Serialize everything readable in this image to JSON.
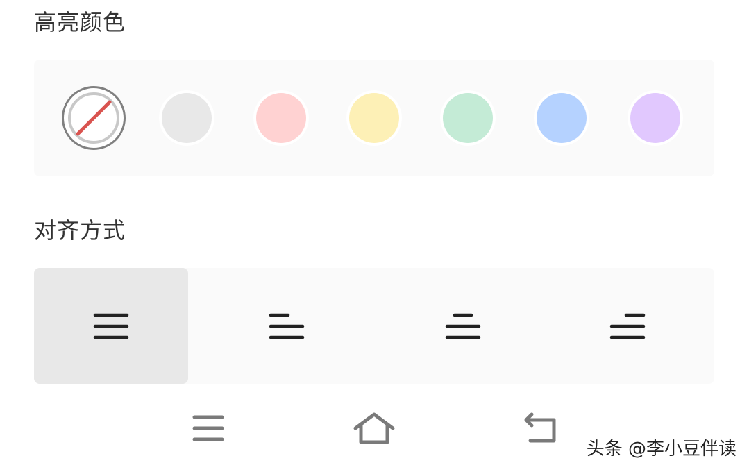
{
  "highlight_section": {
    "title": "高亮颜色",
    "none_option": {
      "icon": "no-color-slash-icon"
    },
    "colors": [
      {
        "name": "gray",
        "hex": "#e8e8e8"
      },
      {
        "name": "red",
        "hex": "#ffd2d2"
      },
      {
        "name": "yellow",
        "hex": "#fdf0b6"
      },
      {
        "name": "green",
        "hex": "#c4ebd6"
      },
      {
        "name": "blue",
        "hex": "#b5d2ff"
      },
      {
        "name": "purple",
        "hex": "#e1c8fe"
      }
    ]
  },
  "align_section": {
    "title": "对齐方式",
    "selected": "justify",
    "options": [
      {
        "id": "justify",
        "icon": "align-justify-icon"
      },
      {
        "id": "left",
        "icon": "align-left-icon"
      },
      {
        "id": "center",
        "icon": "align-center-icon"
      },
      {
        "id": "right",
        "icon": "align-right-icon"
      }
    ]
  },
  "navbar": {
    "buttons": [
      {
        "id": "menu",
        "icon": "menu-icon"
      },
      {
        "id": "home",
        "icon": "home-icon"
      },
      {
        "id": "back",
        "icon": "back-icon"
      }
    ]
  },
  "watermark": {
    "text": "头条 @李小豆伴读"
  },
  "colors": {
    "title_text": "#333333",
    "panel_bg": "#fafafa",
    "selected_bg": "#e8e8e8",
    "icon_dark": "#222222",
    "nav_icon": "#7a7a7a",
    "slash_red": "#d9534f"
  }
}
